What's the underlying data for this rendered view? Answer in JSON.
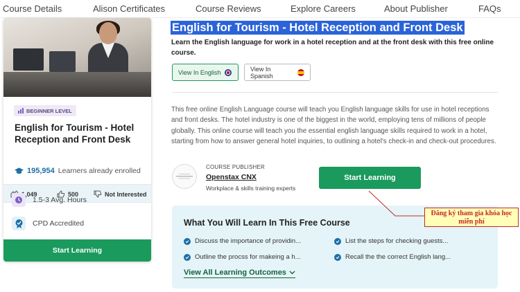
{
  "nav": {
    "items": [
      "Course Details",
      "Alison Certificates",
      "Course Reviews",
      "Explore Careers",
      "About Publisher",
      "FAQs"
    ]
  },
  "card": {
    "level": "BEGINNER LEVEL",
    "title": "English for Tourism - Hotel Reception and Front Desk",
    "enrolled_count": "195,954",
    "enrolled_label": "Learners already enrolled",
    "stats": {
      "likes": "1,049",
      "thumbs": "500",
      "not_interested": "Not Interested"
    },
    "duration": "1.5-3 Avg. Hours",
    "accreditation": "CPD Accredited",
    "button": "Start Learning"
  },
  "course": {
    "title": "English for Tourism - Hotel Reception and Front Desk",
    "subtitle": "Learn the English language for work in a hotel reception and at the front desk with this free online course.",
    "lang_english": "View In English",
    "lang_spanish": "View In Spanish",
    "description": "This free online English Language course will teach you English language skills for use in hotel receptions and front desks. The hotel industry is one of the biggest in the world, employing tens of millions of people globally. This online course will teach you the essential english language skills required to work in a hotel, starting from how to answer general hotel inquiries, to outlining a hotel's check-in and check-out procedures."
  },
  "publisher": {
    "label": "COURSE PUBLISHER",
    "name": "Openstax CNX",
    "description": "Workplace & skills training experts"
  },
  "main_button": "Start Learning",
  "callout": {
    "text": "Đăng ký tham gia khóa học miễn phí"
  },
  "learn": {
    "title": "What You Will Learn In This Free Course",
    "items": [
      "Discuss the importance of providin...",
      "List the steps for checking guests...",
      "Outline the procss for makeing a h...",
      "Recall the the correct English lang..."
    ],
    "view_all": "View All Learning Outcomes"
  },
  "colors": {
    "accent_green": "#1a9a5c",
    "highlight_blue": "#2b63d9",
    "callout_red": "#c62828",
    "callout_bg": "#ffffb8"
  }
}
